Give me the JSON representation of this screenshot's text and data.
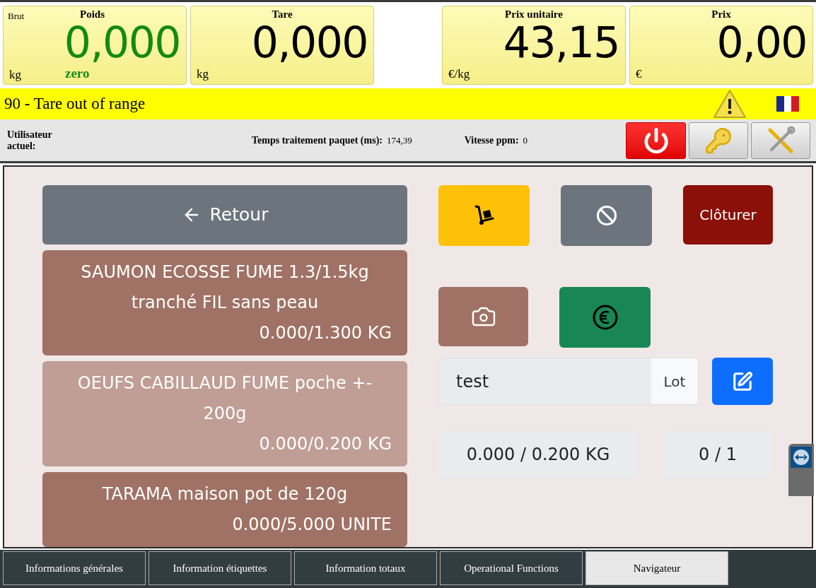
{
  "displays": [
    {
      "label": "Poids",
      "corner_label": "Brut",
      "value": "0,000",
      "unit": "kg",
      "status": "zero",
      "zero": true
    },
    {
      "label": "Tare",
      "value": "0,000",
      "unit": "kg",
      "zero": false
    },
    {
      "kind": "gap"
    },
    {
      "label": "Prix unitaire",
      "value": "43,15",
      "unit": "€/kg",
      "zero": false
    },
    {
      "label": "Prix",
      "value": "0,00",
      "unit": "€",
      "zero": false
    }
  ],
  "alert": {
    "message": "90 - Tare out of range"
  },
  "info_bar": {
    "user_label": "Utilisateur actuel:",
    "time_label": "Temps traitement paquet (ms):",
    "time_value": "174,39",
    "speed_label": "Vitesse ppm:",
    "speed_value": "0"
  },
  "back_button": {
    "label": "Retour"
  },
  "products": [
    {
      "lines": [
        "SAUMON ECOSSE FUME 1.3/1.5kg",
        "tranché FIL sans peau"
      ],
      "quantity": "0.000/1.300 KG",
      "selected": false
    },
    {
      "lines": [
        "OEUFS CABILLAUD FUME poche +-",
        "200g"
      ],
      "quantity": "0.000/0.200 KG",
      "selected": true
    },
    {
      "lines": [
        "TARAMA maison pot de 120g"
      ],
      "quantity": "0.000/5.000 UNITE",
      "selected": false
    }
  ],
  "actions": {
    "close_label": "Clôturer"
  },
  "lot_field": {
    "value": "test",
    "addon": "Lot"
  },
  "weight_readout": "0.000 / 0.200 KG",
  "count_readout": "0 / 1",
  "tabs": [
    {
      "label": "Informations générales",
      "selected": false
    },
    {
      "label": "Information étiquettes",
      "selected": false
    },
    {
      "label": "Information totaux",
      "selected": false
    },
    {
      "label": "Operational Functions",
      "selected": false
    },
    {
      "label": "Navigateur",
      "selected": true
    }
  ]
}
